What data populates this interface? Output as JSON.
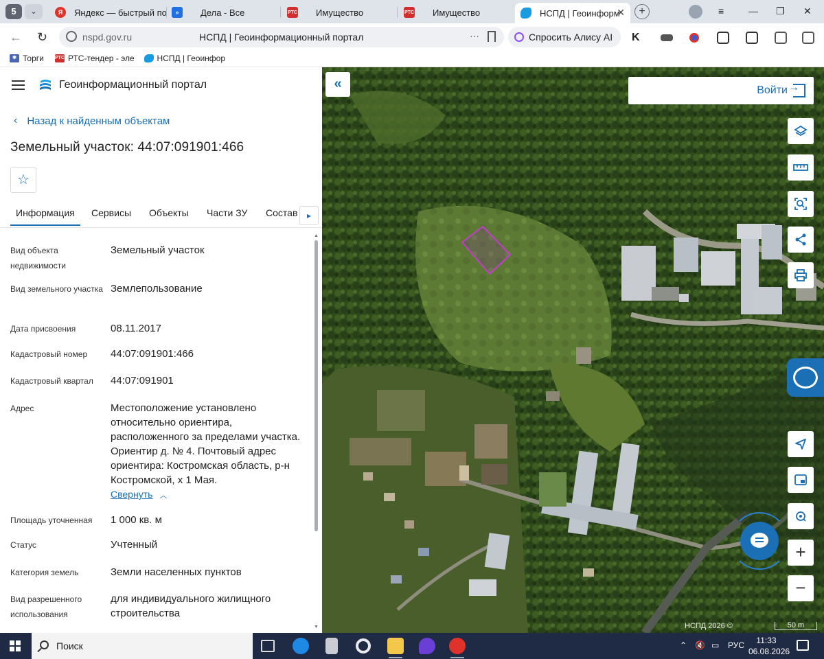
{
  "browser": {
    "tab_counter": "5",
    "tabs": [
      {
        "label": "Яндекс — быстрый по",
        "fav_color": "#e0312b",
        "fav_text": "Я"
      },
      {
        "label": "Дела - Все",
        "fav_color": "#1f6fe5",
        "fav_text": "»"
      },
      {
        "label": "Имущество",
        "fav_color": "#d32f2f",
        "fav_text": "РТС"
      },
      {
        "label": "Имущество",
        "fav_color": "#d32f2f",
        "fav_text": "РТС"
      },
      {
        "label": "НСПД | Геоинформ",
        "fav_color": "#1a9be0",
        "fav_text": ""
      }
    ],
    "url": "nspd.gov.ru",
    "page_title": "НСПД | Геоинформационный портал",
    "alice_label": "Спросить Алису AI",
    "bookmarks": [
      {
        "label": "Торги",
        "fav_color": "#4a66b0",
        "fav_text": "✾"
      },
      {
        "label": "РТС-тендер - эле",
        "fav_color": "#d32f2f",
        "fav_text": "РТС"
      },
      {
        "label": "НСПД | Геоинфор",
        "fav_color": "#1a9be0",
        "fav_text": ""
      }
    ]
  },
  "portal": {
    "name": "Геоинформационный портал",
    "back_label": "Назад к найденным объектам",
    "title": "Земельный участок: 44:07:091901:466",
    "tabs": [
      "Информация",
      "Сервисы",
      "Объекты",
      "Части ЗУ",
      "Состав"
    ],
    "fields": [
      {
        "label": "Вид объекта недвижимости",
        "value": "Земельный участок"
      },
      {
        "label": "Вид земельного участка",
        "value": "Землепользование"
      },
      {
        "label": "Дата присвоения",
        "value": "08.11.2017"
      },
      {
        "label": "Кадастровый номер",
        "value": "44:07:091901:466"
      },
      {
        "label": "Кадастровый квартал",
        "value": "44:07:091901"
      },
      {
        "label": "Адрес",
        "value": "Местоположение установлено относительно ориентира, расположенного за пределами участка. Ориентир д. № 4. Почтовый адрес ориентира: Костромская область, р-н Костромской, х 1 Мая."
      },
      {
        "label": "Площадь уточненная",
        "value": "1 000 кв. м"
      },
      {
        "label": "Статус",
        "value": "Учтенный"
      },
      {
        "label": "Категория земель",
        "value": "Земли населенных пунктов"
      },
      {
        "label": "Вид разрешенного использования",
        "value": "для индивидуального жилищного строительства"
      }
    ],
    "collapse_label": "Свернуть"
  },
  "map": {
    "login_label": "Войти",
    "attribution": "НСПД 2026 ©",
    "scale": "50 m",
    "parcel_color": "#c040c8"
  },
  "taskbar": {
    "search_label": "Поиск",
    "lang": "РУС",
    "time": "11:33",
    "date": "06.08.2026"
  },
  "colors": {
    "accent": "#1a6fb5",
    "taskbar": "#1f2a44"
  }
}
